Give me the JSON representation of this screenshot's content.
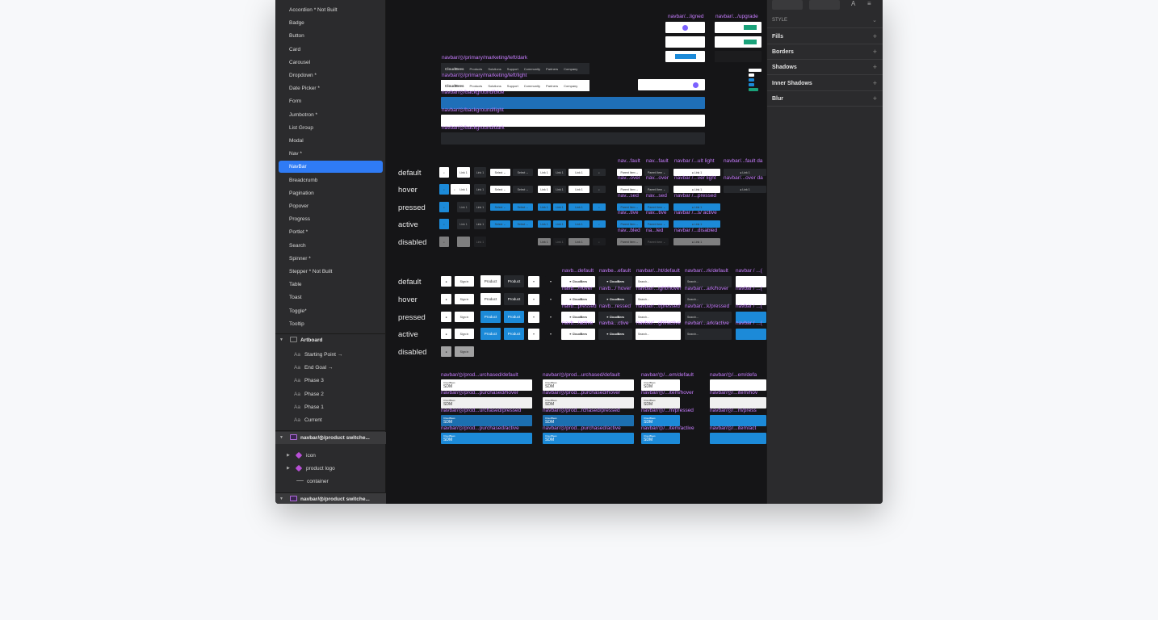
{
  "sidebar": {
    "items": [
      {
        "label": "Accordion * Not Built"
      },
      {
        "label": "Badge"
      },
      {
        "label": "Button"
      },
      {
        "label": "Card"
      },
      {
        "label": "Carousel"
      },
      {
        "label": "Dropdown *"
      },
      {
        "label": "Date Picker *"
      },
      {
        "label": "Form"
      },
      {
        "label": "Jumbotron *"
      },
      {
        "label": "List Group"
      },
      {
        "label": "Modal"
      },
      {
        "label": "Nav *"
      },
      {
        "label": "NavBar"
      },
      {
        "label": "Breadcrumb"
      },
      {
        "label": "Pagination"
      },
      {
        "label": "Popover"
      },
      {
        "label": "Progress"
      },
      {
        "label": "Portlet *"
      },
      {
        "label": "Search"
      },
      {
        "label": "Spinner *"
      },
      {
        "label": "Stepper * Not Built"
      },
      {
        "label": "Table"
      },
      {
        "label": "Toast"
      },
      {
        "label": "Toggle*"
      },
      {
        "label": "Tooltip"
      }
    ],
    "artboard": {
      "label": "Artboard",
      "children": [
        "Starting Point →",
        "End Goal →",
        "Phase 3",
        "Phase 2",
        "Phase 1",
        "Current"
      ]
    },
    "symbol1": {
      "label": "navbar/◎/product switche...",
      "children": [
        "icon",
        "product logo",
        "container"
      ]
    },
    "symbol2": {
      "label": "navbar/◎/product switche..."
    }
  },
  "canvas": {
    "top_labels": {
      "aligned": "navbar/...ligned",
      "upgrade": "navbar/.../upgrade",
      "dark": "navbar/◎/primary/marketing/left/dark",
      "light": "navbar/◎/primary/marketing/left/light",
      "bg_blue": "navbar/◎/background/blue",
      "bg_light": "navbar/◎/background/light",
      "bg_dark": "navbar/◎/background/dark"
    },
    "nav_items": [
      "CloudBees",
      "Products",
      "Solutions",
      "Support",
      "Community",
      "Partners",
      "Company"
    ],
    "states1": [
      "default",
      "hover",
      "pressed",
      "active",
      "disabled"
    ],
    "states1_labels": [
      [
        "nav...fault",
        "nav...fault",
        "navbar /...ult light",
        "navbar/...fault da"
      ],
      [
        "nav...over",
        "nav...over",
        "navbar /...ver light",
        "navbar/...over da"
      ],
      [
        "nav...sed",
        "nav...sed",
        "navbar /...pressed"
      ],
      [
        "nav...tive",
        "nav...tive",
        "navbar /...s/ active"
      ],
      [
        "nav...bled",
        "na...led",
        "navbar /...disabled"
      ]
    ],
    "states2": [
      "default",
      "hover",
      "pressed",
      "active",
      "disabled"
    ],
    "states2_labels": [
      [
        "navb...default",
        "navbe...efault",
        "navbar/...ht/default",
        "navbar/...rk/default",
        "navbar / ...("
      ],
      [
        "navb.../hover",
        "navb.../ hover",
        "navbar/...ight/hover",
        "navbar/...ark/hover",
        "navbar / ...("
      ],
      [
        "navb...pressed",
        "navb...ressed",
        "navbar/...t/pressed",
        "navbar/...k/pressed",
        "navbar / ...("
      ],
      [
        "navb.../active",
        "navba...ctive",
        "navbar/...ght/active",
        "navbar/...ark/active",
        "navbar / ...("
      ]
    ],
    "sdm_labels": [
      [
        "navbar/◎/prod...urchased/default",
        "navbar/◎/prod...urchased/default",
        "navbar/◎/...em/default",
        "navbar/◎/...em/defa"
      ],
      [
        "navbar/◎/prod...purchased/hover",
        "navbar/◎/prod...purchased/hover",
        "navbar/◎/...item/hover",
        "navbar/◎/...item/hov"
      ],
      [
        "navbar/◎/prod...urchased/pressed",
        "navbar/◎/prod...rchased/pressed",
        "navbar/◎/...m/pressed",
        "navbar/◎/...m/press"
      ],
      [
        "navbar/◎/prod...purchased/active",
        "navbar/◎/prod...purchased/active",
        "navbar/◎/...item/active",
        "navbar/◎/...item/act"
      ]
    ],
    "sdm_text": {
      "brand": "CloudBees",
      "product": "SDM"
    },
    "search_placeholder": "Search...",
    "link_label": "Link 1",
    "product_label": "Product",
    "signin_label": "Sign in",
    "colors": {
      "accent": "#2f7bf5",
      "label": "#c77dff",
      "blue_bar": "#1f6fb8",
      "button_blue": "#1c8ad8"
    }
  },
  "inspector": {
    "style_header": "STYLE",
    "sections": [
      "Fills",
      "Borders",
      "Shadows",
      "Inner Shadows",
      "Blur"
    ]
  }
}
